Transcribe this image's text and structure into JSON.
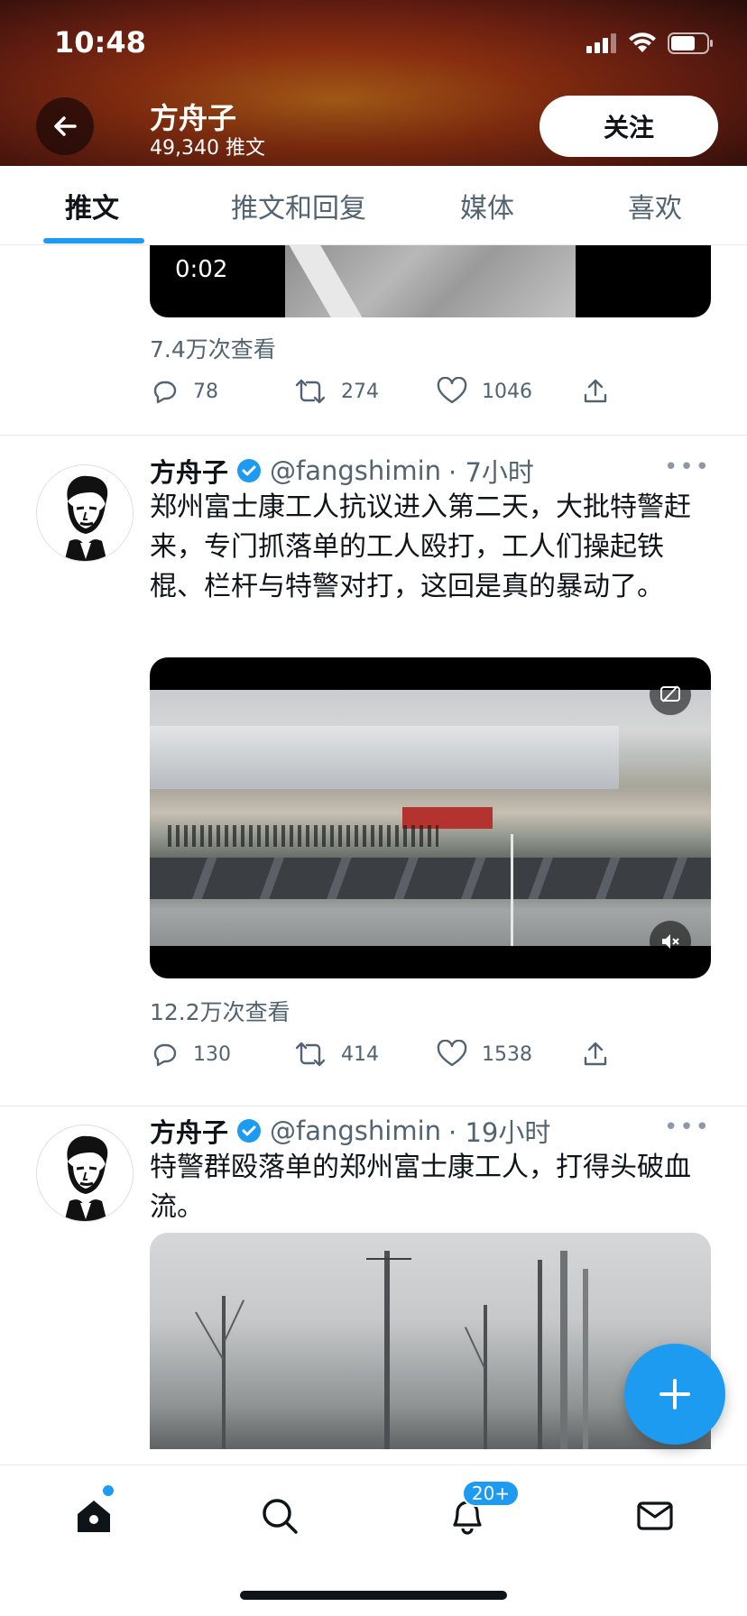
{
  "status_bar": {
    "time": "10:48"
  },
  "header": {
    "name": "方舟子",
    "tweet_count": "49,340 推文",
    "follow_label": "关注"
  },
  "tabs": [
    {
      "label": "推文",
      "active": true
    },
    {
      "label": "推文和回复",
      "active": false
    },
    {
      "label": "媒体",
      "active": false
    },
    {
      "label": "喜欢",
      "active": false
    }
  ],
  "partial_tweet": {
    "duration": "0:02",
    "views": "7.4万次查看",
    "replies": "78",
    "retweets": "274",
    "likes": "1046"
  },
  "tweets": [
    {
      "name": "方舟子",
      "handle": "@fangshimin",
      "time": "· 7小时",
      "text": "郑州富士康工人抗议进入第二天，大批特警赶来，专门抓落单的工人殴打，工人们操起铁棍、栏杆与特警对打，这回是真的暴动了。",
      "views": "12.2万次查看",
      "replies": "130",
      "retweets": "414",
      "likes": "1538"
    },
    {
      "name": "方舟子",
      "handle": "@fangshimin",
      "time": "· 19小时",
      "text": "特警群殴落单的郑州富士康工人，打得头破血流。"
    }
  ],
  "bottom_nav": {
    "notifications_badge": "20+"
  },
  "colors": {
    "accent": "#1d9bf0",
    "text": "#0f1419",
    "muted": "#536471"
  }
}
